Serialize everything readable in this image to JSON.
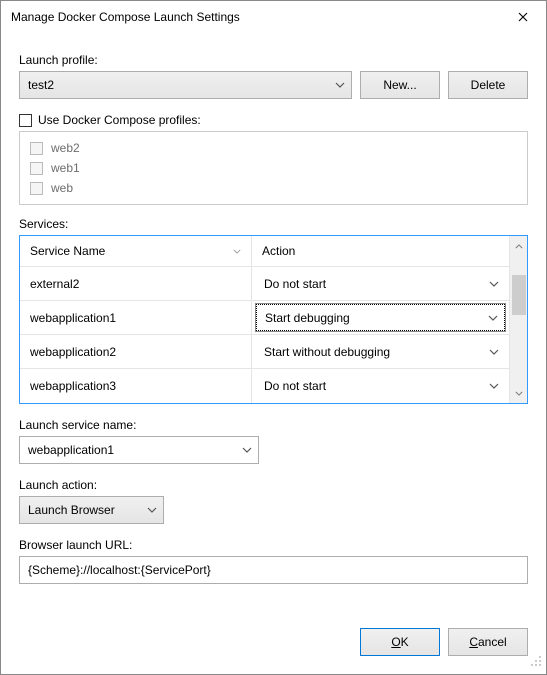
{
  "window": {
    "title": "Manage Docker Compose Launch Settings"
  },
  "labels": {
    "launchProfile": "Launch profile:",
    "useProfiles": "Use Docker Compose profiles:",
    "services": "Services:",
    "serviceNameCol": "Service Name",
    "actionCol": "Action",
    "launchServiceName": "Launch service name:",
    "launchAction": "Launch action:",
    "browserLaunchUrl": "Browser launch URL:"
  },
  "profileDropdown": {
    "value": "test2"
  },
  "buttons": {
    "new": "New...",
    "delete": "Delete",
    "ok": "OK",
    "cancel": "Cancel"
  },
  "composeProfiles": [
    {
      "label": "web2"
    },
    {
      "label": "web1"
    },
    {
      "label": "web"
    }
  ],
  "services": [
    {
      "name": "external2",
      "action": "Do not start"
    },
    {
      "name": "webapplication1",
      "action": "Start debugging",
      "focused": true
    },
    {
      "name": "webapplication2",
      "action": "Start without debugging"
    },
    {
      "name": "webapplication3",
      "action": "Do not start"
    }
  ],
  "launchServiceName": {
    "value": "webapplication1"
  },
  "launchAction": {
    "value": "Launch Browser"
  },
  "browserLaunchUrl": {
    "value": "{Scheme}://localhost:{ServicePort}"
  }
}
